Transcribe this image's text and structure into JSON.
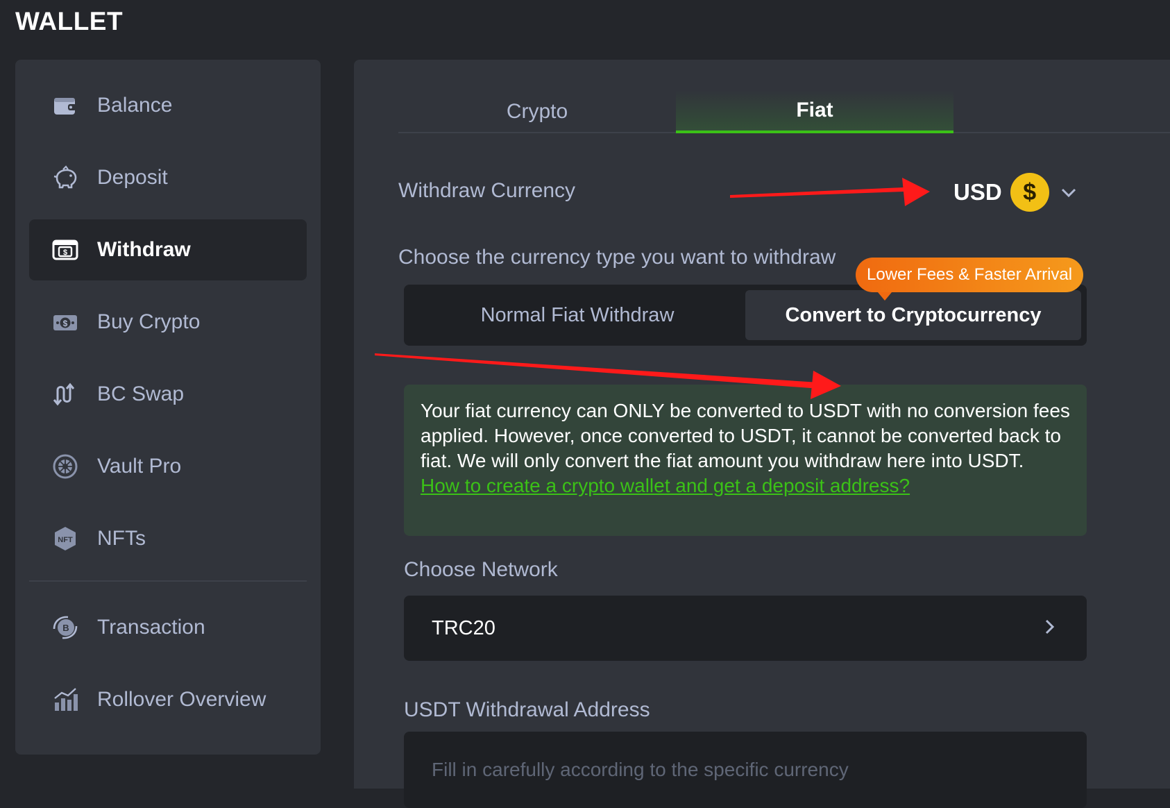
{
  "header": {
    "title": "WALLET"
  },
  "sidebar": {
    "items": [
      {
        "label": "Balance",
        "icon": "wallet-icon"
      },
      {
        "label": "Deposit",
        "icon": "piggy-bank-icon"
      },
      {
        "label": "Withdraw",
        "icon": "cash-register-icon",
        "active": true
      },
      {
        "label": "Buy Crypto",
        "icon": "banknote-icon"
      },
      {
        "label": "BC Swap",
        "icon": "swap-arrows-icon"
      },
      {
        "label": "Vault Pro",
        "icon": "vault-icon"
      },
      {
        "label": "NFTs",
        "icon": "nft-icon"
      },
      {
        "label": "Transaction",
        "icon": "transaction-coin-icon"
      },
      {
        "label": "Rollover Overview",
        "icon": "bar-chart-icon"
      }
    ]
  },
  "tabs": [
    {
      "label": "Crypto",
      "active": false
    },
    {
      "label": "Fiat",
      "active": true
    }
  ],
  "withdraw_currency": {
    "label": "Withdraw Currency",
    "code": "USD",
    "symbol": "$"
  },
  "currency_type": {
    "label": "Choose the currency type you want to withdraw",
    "options": [
      {
        "label": "Normal Fiat Withdraw",
        "active": false
      },
      {
        "label": "Convert to Cryptocurrency",
        "active": true
      }
    ],
    "badge": "Lower Fees & Faster Arrival"
  },
  "info": {
    "text": "Your fiat currency can ONLY be converted to USDT with no conversion fees applied. However, once converted to USDT, it cannot be converted back to fiat. We will only convert the fiat amount you withdraw here into USDT.",
    "link": "How to create a crypto wallet and get a deposit address?"
  },
  "network": {
    "label": "Choose Network",
    "value": "TRC20"
  },
  "address": {
    "label": "USDT Withdrawal Address",
    "placeholder": "Fill in carefully according to the specific currency"
  },
  "colors": {
    "accent_green": "#3bc117",
    "annotation_red": "#ff1a1a",
    "badge_orange": "#f06a10",
    "coin_yellow": "#f2c015"
  }
}
